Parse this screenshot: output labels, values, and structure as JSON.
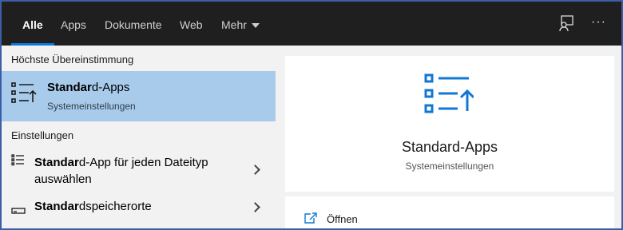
{
  "tabs": [
    {
      "label": "Alle",
      "active": true
    },
    {
      "label": "Apps"
    },
    {
      "label": "Dokumente"
    },
    {
      "label": "Web"
    },
    {
      "label": "Mehr"
    }
  ],
  "toolbar": {
    "feedback_icon": "feedback-icon",
    "more_icon": "more-options-icon",
    "more_label": "···"
  },
  "left": {
    "best_match_header": "Höchste Übereinstimmung",
    "best_match": {
      "title_bold": "Standar",
      "title_rest": "d-Apps",
      "subtitle": "Systemeinstellungen",
      "icon": "default-apps-icon"
    },
    "settings_header": "Einstellungen",
    "items": [
      {
        "bold": "Standar",
        "rest_line1": "d-App für jeden Dateityp",
        "line2": "auswählen",
        "icon": "file-type-list-icon"
      },
      {
        "bold": "Standar",
        "rest_line1": "dspeicherorte",
        "icon": "storage-icon"
      }
    ]
  },
  "detail": {
    "title": "Standard-Apps",
    "subtitle": "Systemeinstellungen",
    "icon": "default-apps-icon"
  },
  "actions": [
    {
      "label": "Öffnen",
      "icon": "open-icon"
    }
  ],
  "colors": {
    "accent": "#0a78d7",
    "selection": "#a8cbeb",
    "topbar": "#1f1f1f"
  }
}
